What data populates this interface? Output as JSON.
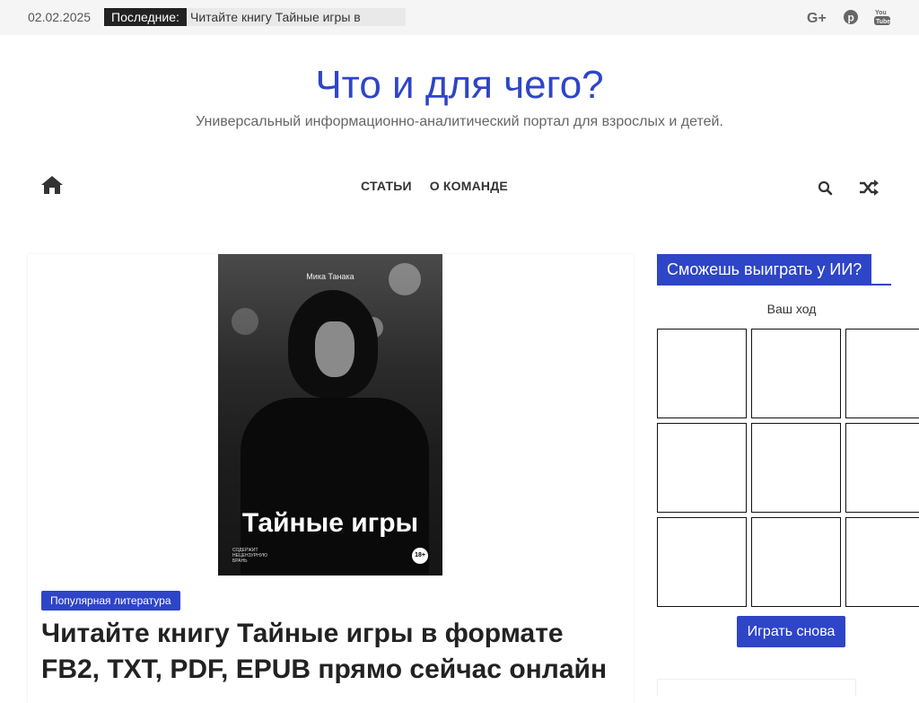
{
  "topbar": {
    "date": "02.02.2025",
    "latest_label": "Последние:",
    "latest_item": "Читайте книгу Тайные игры в"
  },
  "header": {
    "site_title": "Что и для чего?",
    "site_description": "Универсальный информационно-аналитический портал для взрослых и детей."
  },
  "nav": {
    "items": [
      {
        "label": "СТАТЬИ"
      },
      {
        "label": "О КОМАНДЕ"
      }
    ]
  },
  "article": {
    "cover_author": "Мика Танака",
    "cover_title": "Тайные игры",
    "cover_age": "18+",
    "cover_warning": "СОДЕРЖИТ НЕЦЕНЗУРНУЮ БРАНЬ",
    "category": "Популярная литература",
    "title": "Читайте книгу Тайные игры в формате FB2, TXT, PDF, EPUB прямо сейчас онлайн"
  },
  "sidebar": {
    "game_title": "Сможешь выиграть у ИИ?",
    "turn_text": "Ваш ход",
    "replay_label": "Играть снова"
  },
  "colors": {
    "accent": "#2e45c7",
    "topbar_bg": "#f5f5f5",
    "latest_label_bg": "#222222"
  },
  "icons": {
    "social": [
      "google-plus-icon",
      "pinterest-icon",
      "youtube-icon"
    ],
    "nav": [
      "home-icon",
      "search-icon",
      "random-shuffle-icon"
    ]
  }
}
